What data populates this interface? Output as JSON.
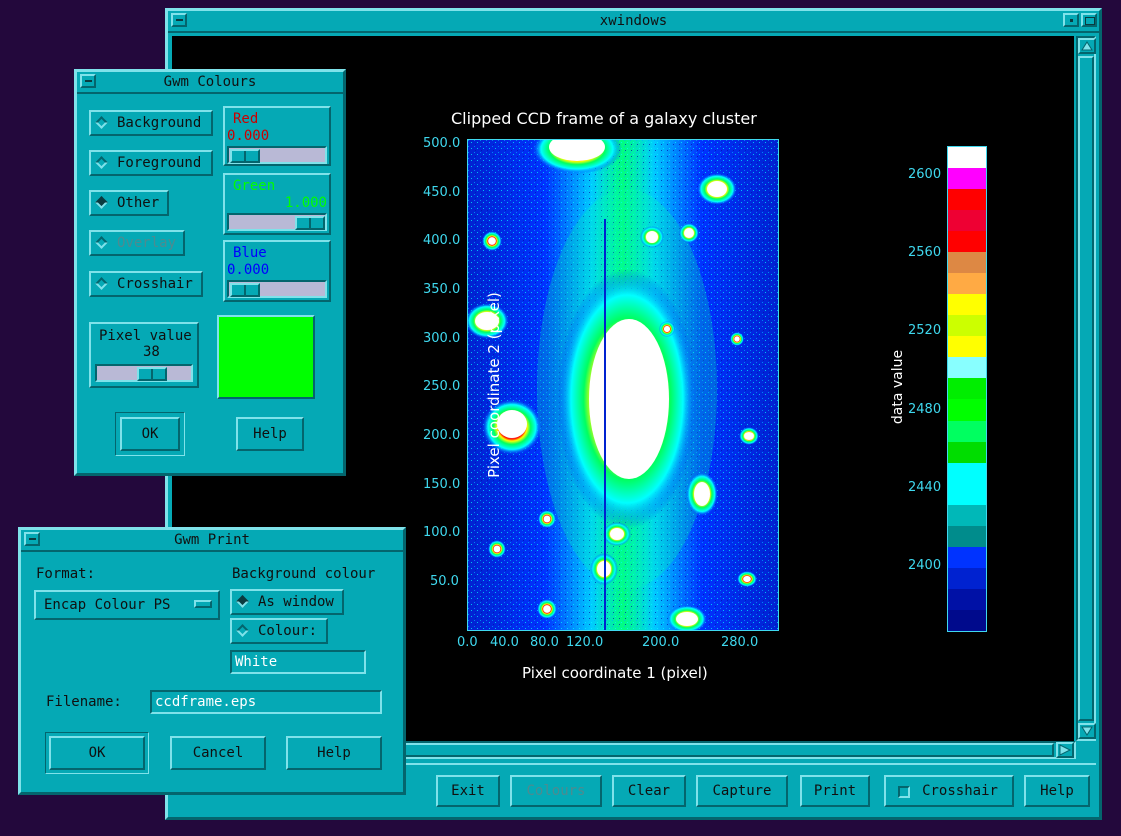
{
  "main_window": {
    "title": "xwindows",
    "buttons": [
      {
        "label": "Exit",
        "enabled": true
      },
      {
        "label": "Colours",
        "enabled": false
      },
      {
        "label": "Clear",
        "enabled": true
      },
      {
        "label": "Capture",
        "enabled": true
      },
      {
        "label": "Print",
        "enabled": true
      },
      {
        "label": "Crosshair",
        "enabled": true,
        "toggle": true,
        "checked": false
      },
      {
        "label": "Help",
        "enabled": true
      }
    ],
    "icons": {
      "h_scroll_arrow": "right-arrow-icon",
      "v_scroll_up": "up-arrow-icon",
      "v_scroll_down": "down-arrow-icon"
    }
  },
  "plot": {
    "title": "Clipped CCD frame of a galaxy cluster",
    "xlabel": "Pixel coordinate 1 (pixel)",
    "ylabel": "Pixel coordinate 2 (pixel)",
    "xticks": [
      "0.0",
      "40.0",
      "80.0",
      "120.0",
      "200.0",
      "280.0"
    ],
    "yticks": [
      "50.0",
      "100.0",
      "150.0",
      "200.0",
      "250.0",
      "300.0",
      "350.0",
      "400.0",
      "450.0",
      "500.0"
    ],
    "colorbar_label": "data value",
    "colorbar_ticks": [
      "2600",
      "2560",
      "2520",
      "2480",
      "2440",
      "2400"
    ],
    "colors": {
      "axis": "#3fd8ee",
      "text": "#ffffff",
      "background": "#000000"
    }
  },
  "chart_data": {
    "type": "heatmap",
    "title": "Clipped CCD frame of a galaxy cluster",
    "xlabel": "Pixel coordinate 1 (pixel)",
    "ylabel": "Pixel coordinate 2 (pixel)",
    "xlim": [
      0,
      320
    ],
    "ylim": [
      0,
      500
    ],
    "colorbar": {
      "label": "data value",
      "range": [
        2380,
        2610
      ],
      "ticks": [
        2400,
        2440,
        2480,
        2520,
        2560,
        2600
      ],
      "color_levels": [
        "#000a8c",
        "#0011a6",
        "#0022d0",
        "#0033ff",
        "#008c8c",
        "#00b8b8",
        "#00ffff",
        "#00ffff",
        "#00dd00",
        "#00ff60",
        "#00ff00",
        "#00ee00",
        "#88ffff",
        "#ffff00",
        "#ccff00",
        "#ffff00",
        "#ffaa44",
        "#dd8844",
        "#ff0000",
        "#ee0033",
        "#ff0000",
        "#ff00ff",
        "#ffffff"
      ]
    }
  },
  "colours_dialog": {
    "title": "Gwm Colours",
    "radios": [
      {
        "label": "Background",
        "selected": false,
        "enabled": true
      },
      {
        "label": "Foreground",
        "selected": false,
        "enabled": true
      },
      {
        "label": "Other",
        "selected": true,
        "enabled": true
      },
      {
        "label": "Overlay",
        "selected": false,
        "enabled": false
      },
      {
        "label": "Crosshair",
        "selected": false,
        "enabled": true
      }
    ],
    "red": {
      "label": "Red",
      "value": "0.000",
      "level": 0.0,
      "color": "#cc0000"
    },
    "green": {
      "label": "Green",
      "value": "1.000",
      "level": 1.0,
      "color": "#00ff00"
    },
    "blue": {
      "label": "Blue",
      "value": "0.000",
      "level": 0.0,
      "color": "#0000ff"
    },
    "pixel_value": {
      "label": "Pixel value",
      "value": "38",
      "level": 0.5
    },
    "swatch_color": "#00ff00",
    "ok": "OK",
    "help": "Help"
  },
  "print_dialog": {
    "title": "Gwm Print",
    "format_label": "Format:",
    "format_value": "Encap Colour PS",
    "bg_label": "Background colour",
    "bg_options": [
      {
        "label": "As window",
        "selected": true
      },
      {
        "label": "Colour:",
        "selected": false
      }
    ],
    "bg_colour_value": "White",
    "filename_label": "Filename:",
    "filename_value": "ccdframe.eps",
    "ok": "OK",
    "cancel": "Cancel",
    "help": "Help"
  }
}
